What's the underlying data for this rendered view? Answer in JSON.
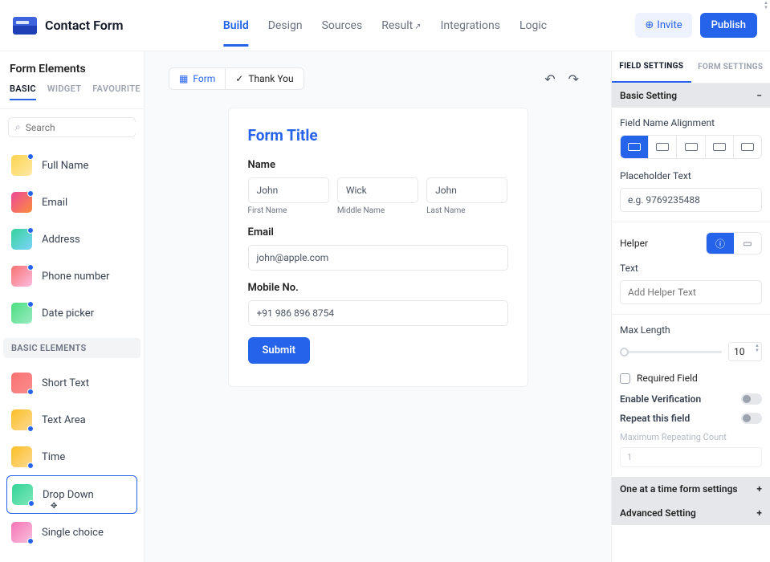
{
  "header": {
    "app_title": "Contact Form",
    "nav": [
      "Build",
      "Design",
      "Sources",
      "Result",
      "Integrations",
      "Logic"
    ],
    "nav_active": "Build",
    "invite_label": "Invite",
    "publish_label": "Publish"
  },
  "left": {
    "title": "Form Elements",
    "tabs": [
      "BASIC",
      "WIDGET",
      "FAVOURITE"
    ],
    "tab_active": "BASIC",
    "search_placeholder": "Search",
    "fields": [
      {
        "label": "Full Name",
        "color1": "#fcd34d",
        "color2": "#ffe9a8"
      },
      {
        "label": "Email",
        "color1": "#ec4899",
        "color2": "#fb8d3c"
      },
      {
        "label": "Address",
        "color1": "#34d399",
        "color2": "#7dd3fc"
      },
      {
        "label": "Phone number",
        "color1": "#f87171",
        "color2": "#fbbde0"
      },
      {
        "label": "Date picker",
        "color1": "#4ade80",
        "color2": "#9bebc1"
      }
    ],
    "section_header": "BASIC ELEMENTS",
    "basic_elements": [
      {
        "label": "Short Text",
        "color1": "#f87171",
        "color2": "#fb8d8d"
      },
      {
        "label": "Text Area",
        "color1": "#fbbf24",
        "color2": "#fcd994"
      },
      {
        "label": "Time",
        "color1": "#fbbf24",
        "color2": "#fcd994"
      },
      {
        "label": "Drop Down",
        "color1": "#34d399",
        "color2": "#7ee8b8",
        "selected": true
      },
      {
        "label": "Single choice",
        "color1": "#f472b6",
        "color2": "#f9c1dc"
      }
    ]
  },
  "canvas": {
    "tab_form": "Form",
    "tab_thank": "Thank You",
    "form_title": "Form Title",
    "name_label": "Name",
    "names": {
      "first": "John",
      "middle": "Wick",
      "last": "John"
    },
    "sublabels": {
      "first": "First Name",
      "middle": "Middle Name",
      "last": "Last Name"
    },
    "email_label": "Email",
    "email_value": "john@apple.com",
    "mobile_label": "Mobile No.",
    "mobile_value": "+91 986 896 8754",
    "submit": "Submit"
  },
  "right": {
    "tabs": [
      "FIELD SETTINGS",
      "FORM SETTINGS"
    ],
    "tab_active": "FIELD SETTINGS",
    "sections": {
      "basic": "Basic Setting",
      "one_at": "One at a time form settings",
      "advanced": "Advanced Setting"
    },
    "labels": {
      "field_align": "Field Name Alignment",
      "placeholder": "Placeholder Text",
      "placeholder_value": "e.g. 9769235488",
      "helper": "Helper",
      "text": "Text",
      "helper_placeholder": "Add Helper Text",
      "max_length": "Max Length",
      "max_length_value": "10",
      "required": "Required Field",
      "enable_verif": "Enable Verification",
      "repeat": "Repeat this field",
      "max_repeat": "Maximum Repeating Count",
      "max_repeat_value": "1"
    }
  }
}
